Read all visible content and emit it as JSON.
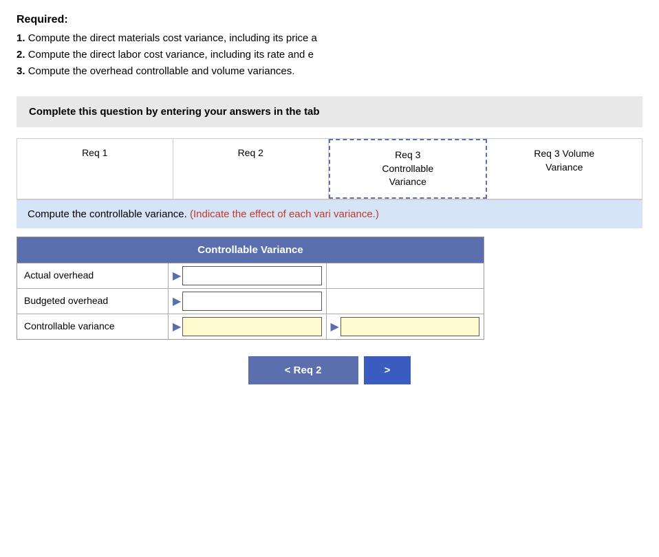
{
  "required": {
    "title": "Required:",
    "items": [
      {
        "num": "1.",
        "text": "Compute the direct materials cost variance, including its price a"
      },
      {
        "num": "2.",
        "text": "Compute the direct labor cost variance, including its rate and e"
      },
      {
        "num": "3.",
        "text": "Compute the overhead controllable and volume variances."
      }
    ]
  },
  "complete_instruction": "Complete this question by entering your answers in the tab",
  "tabs": [
    {
      "label": "Req 1",
      "active": false
    },
    {
      "label": "Req 2",
      "active": false
    },
    {
      "label": "Req 3\nControllable\nVariance",
      "active": true
    },
    {
      "label": "Req 3 Volume\nVariance",
      "active": false
    }
  ],
  "instruction": {
    "black_text": "Compute the controllable variance. ",
    "red_text": "(Indicate the effect of each vari variance.)"
  },
  "table": {
    "header": "Controllable Variance",
    "rows": [
      {
        "label": "Actual overhead",
        "input1": "",
        "input2": null
      },
      {
        "label": "Budgeted overhead",
        "input1": "",
        "input2": null
      },
      {
        "label": "Controllable variance",
        "input1": "",
        "input2": "",
        "yellow": true
      }
    ]
  },
  "nav": {
    "back_label": "< Req 2",
    "next_label": ">"
  }
}
